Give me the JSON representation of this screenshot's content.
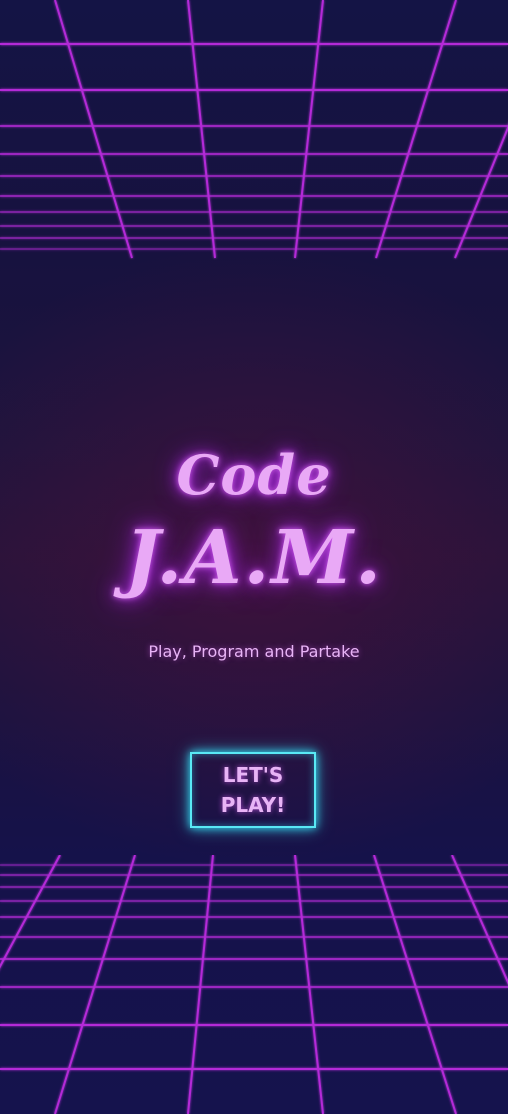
{
  "title": {
    "line1": "Code",
    "line2": "J.A.M."
  },
  "tagline": "Play, Program and Partake",
  "play_button": {
    "label": "LET'S\nPLAY!"
  },
  "colors": {
    "grid_line": "#b42bd8",
    "title": "#e9a9f6",
    "button_border": "#59e9f5",
    "background": "#14103a"
  }
}
